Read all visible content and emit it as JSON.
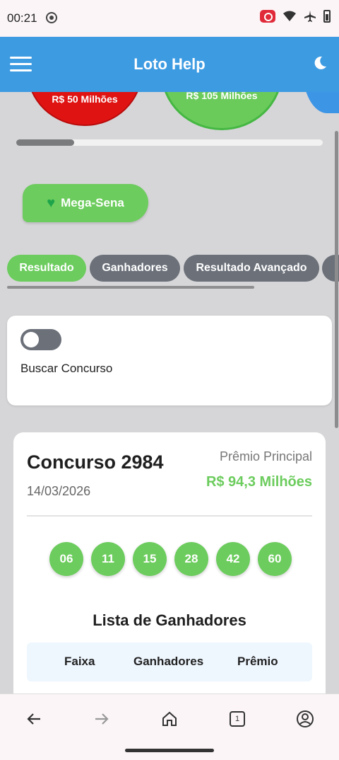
{
  "status": {
    "time": "00:21"
  },
  "app": {
    "title": "Loto Help"
  },
  "carousel": {
    "items": [
      {
        "label": "R$ 50 Milhões",
        "color": "#e01313"
      },
      {
        "label": "R$ 105 Milhões",
        "color": "#6acb5b"
      },
      {
        "label": "",
        "color": "#3d95e6"
      }
    ]
  },
  "lottery": {
    "selected": "Mega-Sena",
    "icon": "green-heart-icon"
  },
  "tabs": [
    {
      "label": "Resultado",
      "active": true
    },
    {
      "label": "Ganhadores",
      "active": false
    },
    {
      "label": "Resultado Avançado",
      "active": false
    }
  ],
  "search": {
    "label": "Buscar Concurso",
    "toggle_on": false
  },
  "result": {
    "contest": "Concurso 2984",
    "date": "14/03/2026",
    "prize_label": "Prêmio Principal",
    "prize_value": "R$ 94,3 Milhões",
    "numbers": [
      "06",
      "11",
      "15",
      "28",
      "42",
      "60"
    ],
    "winners_title": "Lista de Ganhadores",
    "winners_columns": [
      "Faixa",
      "Ganhadores",
      "Prêmio"
    ]
  },
  "browser": {
    "tab_count": "1"
  },
  "colors": {
    "accent": "#3d9be2",
    "green": "#6ccc5d",
    "inactive": "#6b7079"
  }
}
